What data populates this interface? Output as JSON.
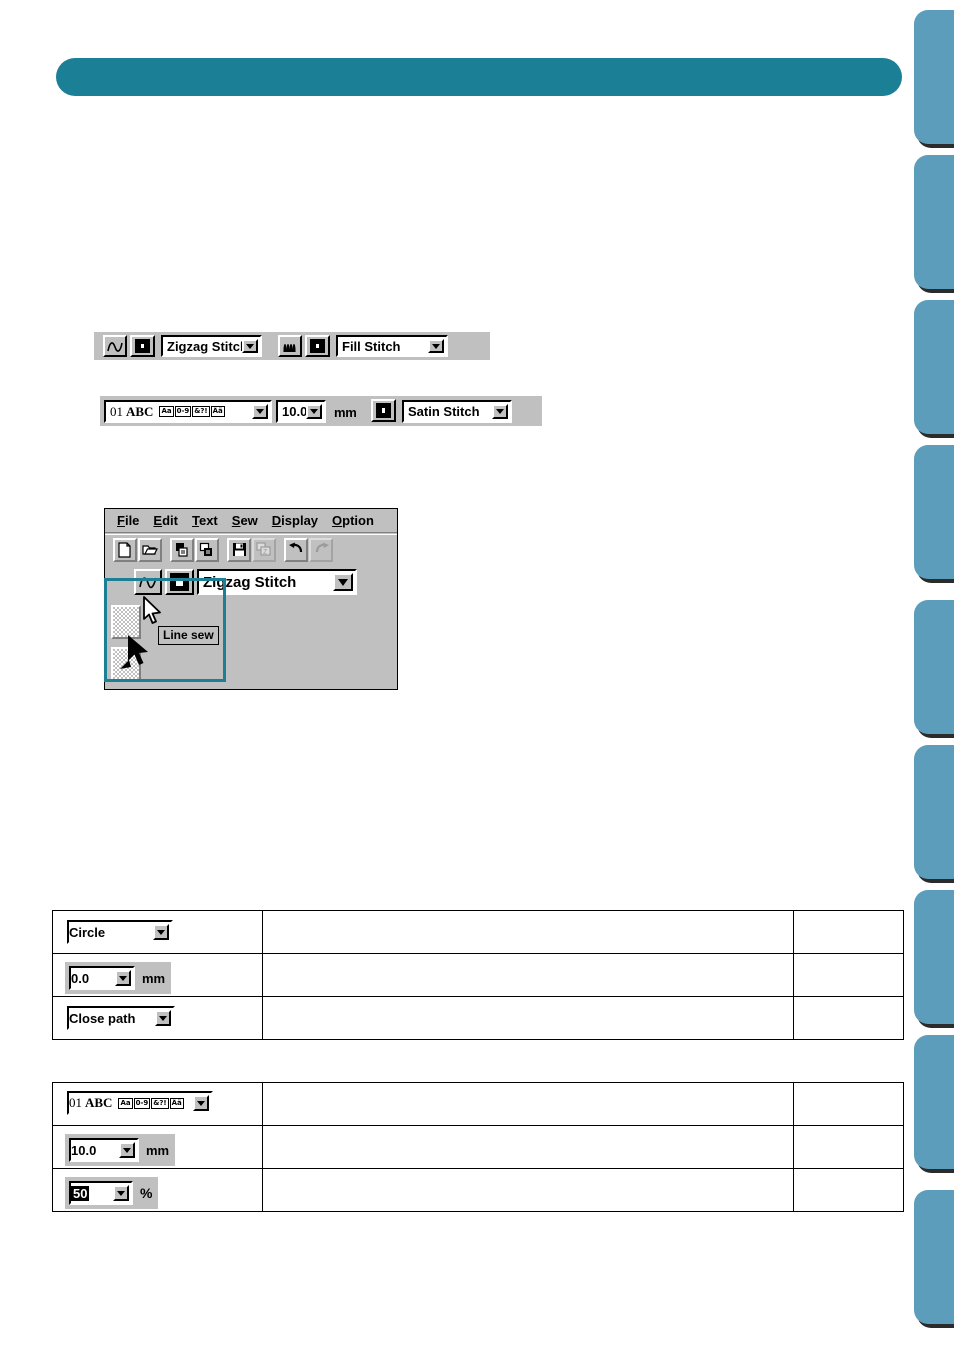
{
  "header": {
    "banner_text": ""
  },
  "side_tabs": [
    {
      "label": ""
    },
    {
      "label": ""
    },
    {
      "label": ""
    },
    {
      "label": ""
    },
    {
      "label": ""
    },
    {
      "label": ""
    },
    {
      "label": ""
    },
    {
      "label": ""
    },
    {
      "label": ""
    }
  ],
  "toolbar_line_sew": {
    "line_sew_icon": "line-sew-icon",
    "line_thread_color_icon": "thread-spool-icon",
    "line_stitch_value": "Zigzag Stitch",
    "region_sew_icon": "region-sew-icon",
    "region_thread_color_icon": "thread-spool-icon",
    "region_stitch_value": "Fill Stitch"
  },
  "toolbar_text": {
    "font_number": "01",
    "font_sample": "ABC",
    "font_charsets": [
      "Aa",
      "0-9",
      "&?!",
      "Ää"
    ],
    "size_value": "10.0",
    "size_unit": "mm",
    "thread_color_icon": "thread-spool-icon",
    "stitch_value": "Satin Stitch"
  },
  "app_window": {
    "menus": [
      {
        "accel": "F",
        "rest": "ile"
      },
      {
        "accel": "E",
        "rest": "dit"
      },
      {
        "accel": "T",
        "rest": "ext"
      },
      {
        "accel": "S",
        "rest": "ew"
      },
      {
        "accel": "D",
        "rest": "isplay"
      },
      {
        "accel": "O",
        "rest": "ption"
      }
    ],
    "toolbuttons": [
      {
        "name": "new-file-button",
        "enabled": true
      },
      {
        "name": "open-file-button",
        "enabled": true
      },
      {
        "name": "import-from-file-button",
        "enabled": true
      },
      {
        "name": "import-from-design-button",
        "enabled": true
      },
      {
        "name": "save-button",
        "enabled": true
      },
      {
        "name": "write-to-card-button",
        "enabled": false
      },
      {
        "name": "undo-button",
        "enabled": true
      },
      {
        "name": "redo-button",
        "enabled": false
      }
    ],
    "line_sew_icon": "line-sew-icon",
    "thread_color_icon": "thread-spool-icon",
    "stitch_value": "Zigzag Stitch",
    "tooltip_text": "Line sew",
    "select_tool_icon": "select-arrow-icon",
    "highlight_color": "#1b7f96"
  },
  "table_shape": {
    "rows": [
      {
        "widget": "combo",
        "value": "Circle",
        "unit": "",
        "col2": "",
        "col3": ""
      },
      {
        "widget": "spinner",
        "value": "0.0",
        "unit": "mm",
        "col2": "",
        "col3": ""
      },
      {
        "widget": "combo",
        "value": "Close path",
        "unit": "",
        "col2": "",
        "col3": ""
      }
    ]
  },
  "table_text": {
    "rows": [
      {
        "widget": "font",
        "value": "01",
        "sample": "ABC",
        "charsets": [
          "Aa",
          "0-9",
          "&?!",
          "Ää"
        ],
        "unit": "",
        "col2": "",
        "col3": ""
      },
      {
        "widget": "spinner",
        "value": "10.0",
        "unit": "mm",
        "col2": "",
        "col3": ""
      },
      {
        "widget": "spinner-selected",
        "value": "50",
        "unit": "%",
        "col2": "",
        "col3": ""
      }
    ]
  },
  "colors": {
    "banner": "#1b7f96",
    "side_tab": "#5b9dba",
    "side_tab_shadow": "#2b2b2b",
    "window_face": "#c0c0c0",
    "highlight": "#1b7f96"
  }
}
